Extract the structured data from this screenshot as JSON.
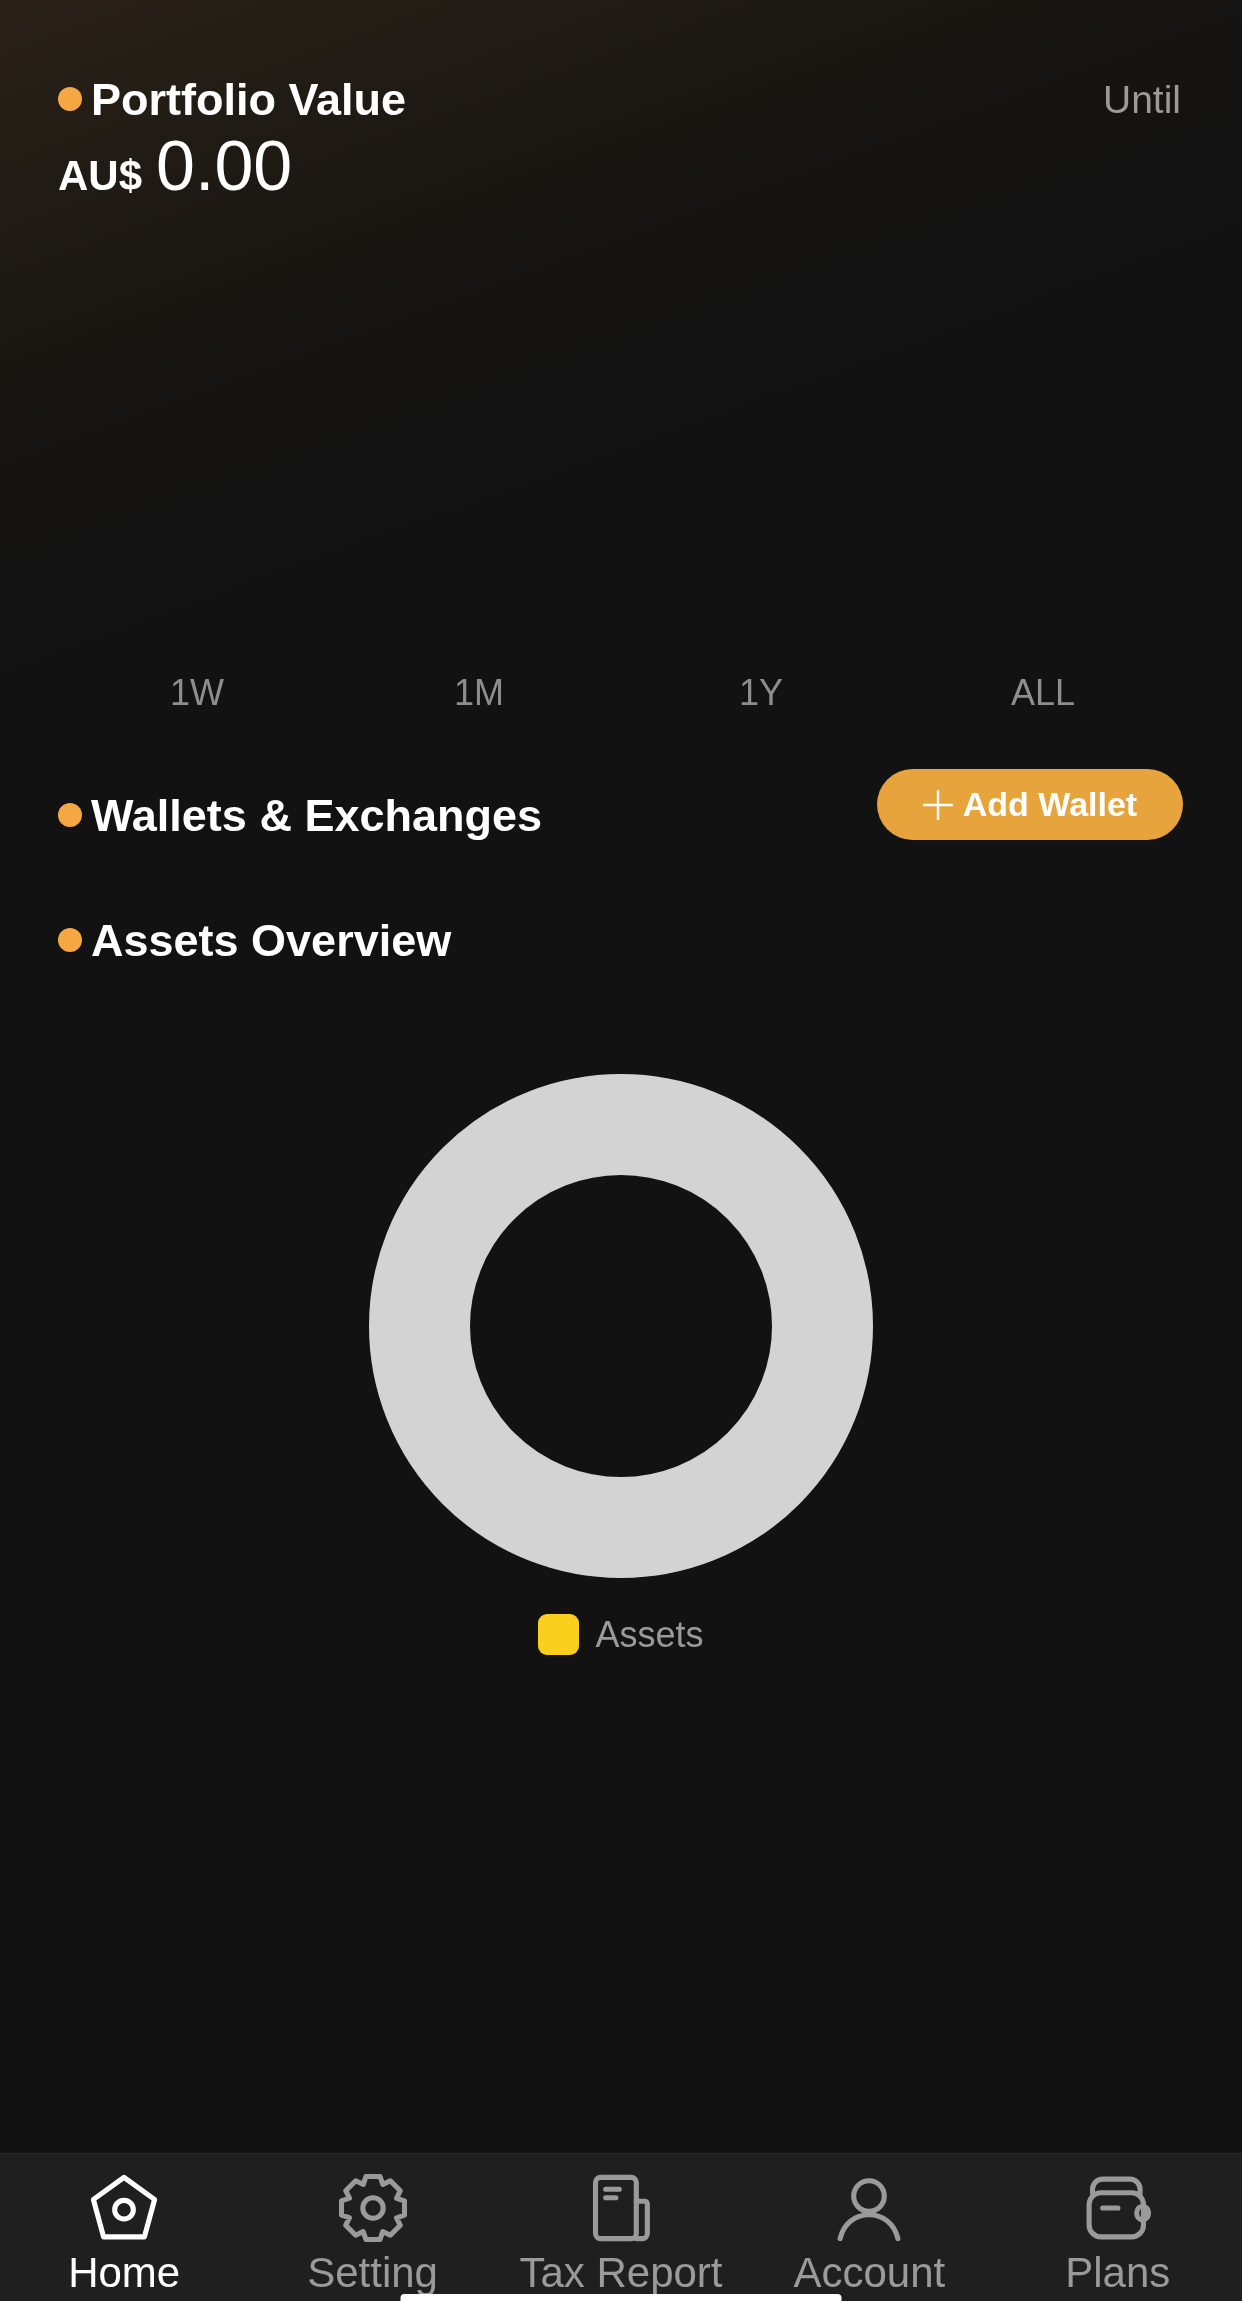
{
  "portfolio": {
    "title": "Portfolio Value",
    "currency": "AU$",
    "amount": "0.00",
    "until": "Until"
  },
  "range_tabs": [
    {
      "label": "1W",
      "selected": false
    },
    {
      "label": "1M",
      "selected": false
    },
    {
      "label": "1Y",
      "selected": false
    },
    {
      "label": "ALL",
      "selected": false
    }
  ],
  "wallets": {
    "title": "Wallets & Exchanges",
    "add_button": "Add Wallet"
  },
  "assets": {
    "title": "Assets Overview",
    "legend": [
      {
        "label": "Assets",
        "color": "#f9cf1c"
      }
    ]
  },
  "nav": [
    {
      "label": "Home",
      "kind": "home",
      "selected": true
    },
    {
      "label": "Setting",
      "kind": "settings",
      "selected": false
    },
    {
      "label": "Tax Report",
      "kind": "report",
      "selected": false
    },
    {
      "label": "Account",
      "kind": "account",
      "selected": false
    },
    {
      "label": "Plans",
      "kind": "plans",
      "selected": false
    }
  ]
}
